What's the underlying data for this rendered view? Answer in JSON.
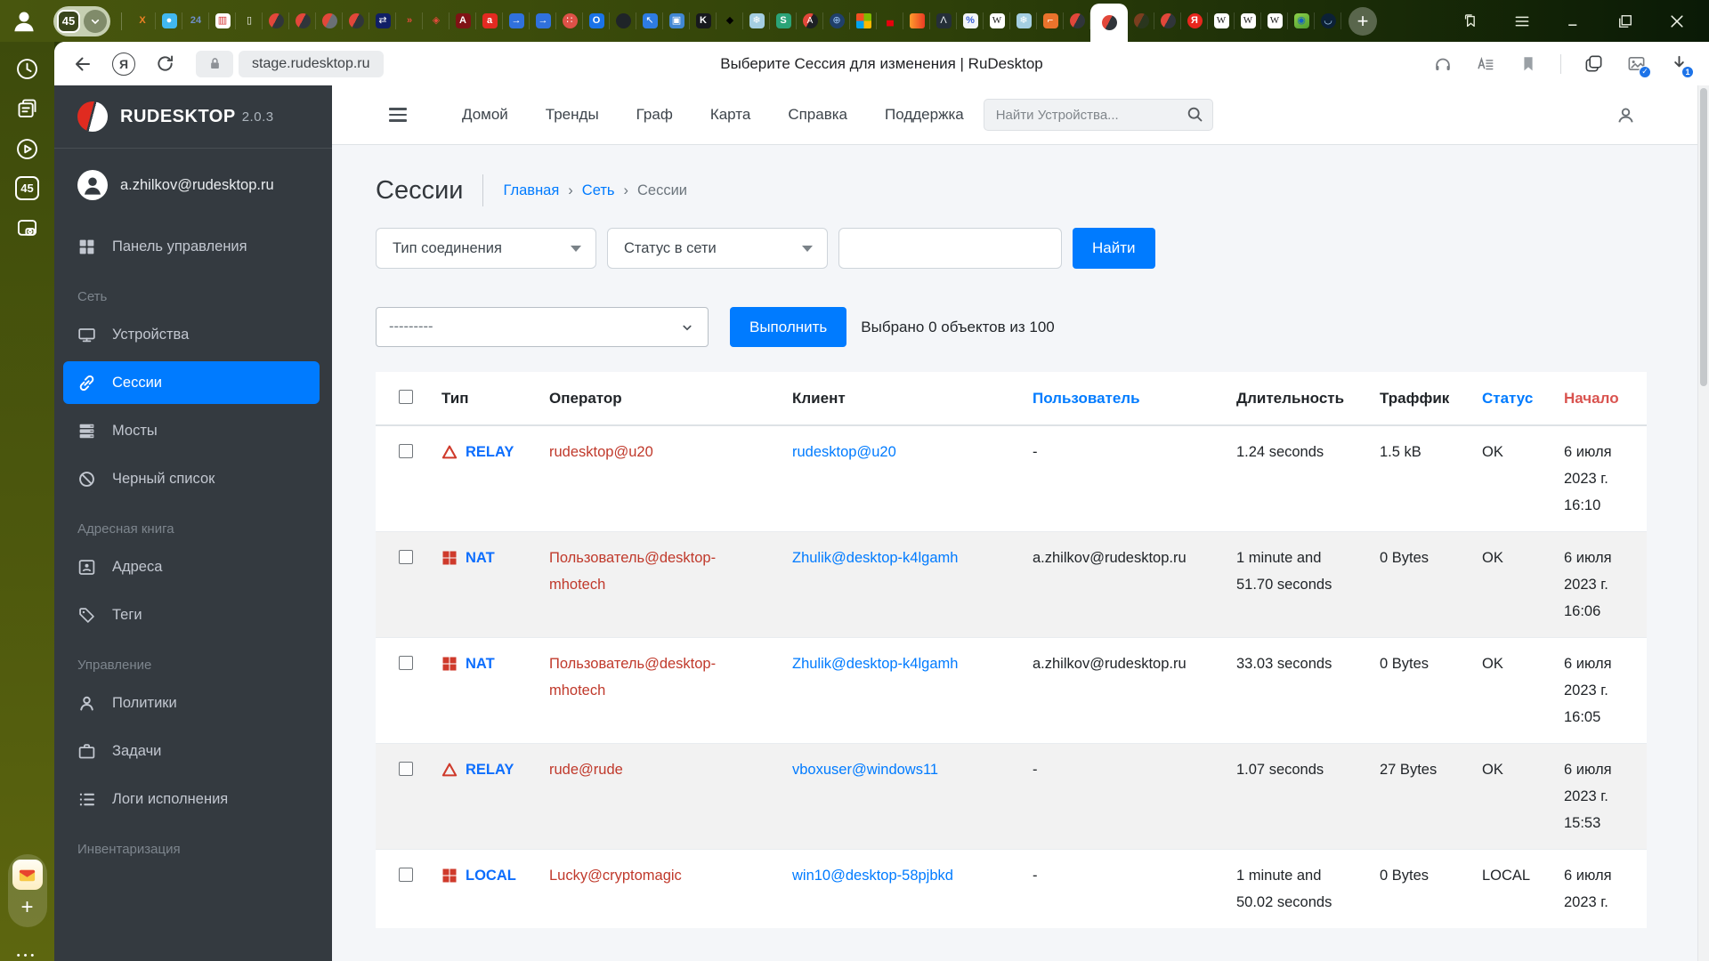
{
  "colors": {
    "accent": "#007bff",
    "type_blue": "#0d6efd",
    "operator_red": "#c0392b",
    "sort_red": "#d9534f",
    "icon_red": "#cf3a2b",
    "sidebar_bg": "#343a40"
  },
  "browser": {
    "page_title": "Выберите Сессия для изменения | RuDesktop",
    "url": "stage.rudesktop.ru",
    "tab_counter": "45",
    "tabs": [
      {
        "s": "no",
        "g": "X",
        "fg": "#f08224",
        "b": true
      },
      {
        "s": "sq",
        "g": "●",
        "bg": "#41b8f1",
        "fg": "#ffffff"
      },
      {
        "s": "no",
        "g": "24",
        "fg": "#6f8fc9",
        "b": true
      },
      {
        "s": "sq",
        "g": "▥",
        "bg": "#ffffff",
        "fg": "#d32f2f"
      },
      {
        "s": "no",
        "g": "▯",
        "fg": "#f2f4ef"
      },
      {
        "s": "rd"
      },
      {
        "s": "rd"
      },
      {
        "s": "rd2"
      },
      {
        "s": "rd"
      },
      {
        "s": "sq",
        "g": "⇄",
        "bg": "#101f66",
        "fg": "#ffffff"
      },
      {
        "s": "no",
        "g": "»",
        "fg": "#e64a3c",
        "b": true
      },
      {
        "s": "no",
        "g": "◈",
        "fg": "#e64a3c"
      },
      {
        "s": "sq",
        "g": "A",
        "bg": "#801315",
        "fg": "#ffffff",
        "b": true
      },
      {
        "s": "sq",
        "g": "a",
        "bg": "#e32a21",
        "fg": "#ffffff",
        "b": true
      },
      {
        "s": "sq",
        "g": "→",
        "bg": "#3071dd",
        "fg": "#ffffff"
      },
      {
        "s": "sq",
        "g": "→",
        "bg": "#3071dd",
        "fg": "#ffffff"
      },
      {
        "s": "ci",
        "g": "∷",
        "bg": "#de5147",
        "fg": "#ffffff"
      },
      {
        "s": "sq",
        "g": "O",
        "bg": "#1a73e8",
        "fg": "#ffffff",
        "b": true
      },
      {
        "s": "ci",
        "g": "",
        "bg": "#1f2428",
        "fg": "#ffffff"
      },
      {
        "s": "sq",
        "g": "↖",
        "bg": "#2e7ce2",
        "fg": "#ffffff"
      },
      {
        "s": "sq",
        "g": "▣",
        "bg": "#4187d3",
        "fg": "#ffffff"
      },
      {
        "s": "sq",
        "g": "K",
        "bg": "#17191d",
        "fg": "#ffffff",
        "b": true
      },
      {
        "s": "no",
        "g": "◆",
        "fg": "#000000"
      },
      {
        "s": "sq",
        "g": "❄",
        "bg": "#a4cee2",
        "fg": "#ffffff"
      },
      {
        "s": "sq",
        "g": "S",
        "bg": "#2ba377",
        "fg": "#ffffff",
        "b": true
      },
      {
        "s": "tr",
        "g": "А"
      },
      {
        "s": "ci",
        "g": "⊕",
        "bg": "#20406b",
        "fg": "#9cc3f0"
      },
      {
        "s": "ms"
      },
      {
        "s": "no",
        "g": "▄",
        "fg": "#e8000d"
      },
      {
        "s": "or"
      },
      {
        "s": "sq",
        "g": "Λ",
        "bg": "#252f38",
        "fg": "#e6ebf0"
      },
      {
        "s": "sq",
        "g": "%",
        "bg": "#f2f5f8",
        "fg": "#3b62da",
        "b": true
      },
      {
        "s": "sq",
        "g": "W",
        "bg": "#ffffff",
        "fg": "#161616",
        "sf": true
      },
      {
        "s": "sq",
        "g": "❄",
        "bg": "#a4cee2",
        "fg": "#ffffff"
      },
      {
        "s": "sq",
        "g": "⌐",
        "bg": "#e9732c",
        "fg": "#ffffff",
        "b": true
      },
      {
        "s": "rd"
      },
      {
        "s": "rd",
        "active": true
      },
      {
        "s": "rd",
        "f": true
      },
      {
        "s": "rd"
      },
      {
        "s": "ci",
        "g": "Я",
        "bg": "#e8261d",
        "fg": "#ffffff",
        "b": true
      },
      {
        "s": "sq",
        "g": "W",
        "bg": "#ffffff",
        "fg": "#161616",
        "sf": true
      },
      {
        "s": "sq",
        "g": "W",
        "bg": "#ffffff",
        "fg": "#161616",
        "sf": true
      },
      {
        "s": "sq",
        "g": "W",
        "bg": "#ffffff",
        "fg": "#161616",
        "sf": true
      },
      {
        "s": "map",
        "g": "◉",
        "fg": "#1461c2"
      },
      {
        "s": "ci",
        "g": "◡",
        "bg": "#0c2136",
        "fg": "#a9d4f5"
      }
    ]
  },
  "strip": {
    "counter": "45"
  },
  "app": {
    "sidebar": {
      "brand": "RUDESKTOP",
      "version": "2.0.3",
      "user": "a.zhilkov@rudesktop.ru",
      "sections": [
        {
          "header": null,
          "items": [
            {
              "icon": "grid",
              "label": "Панель управления"
            }
          ]
        },
        {
          "header": "Сеть",
          "items": [
            {
              "icon": "monitor",
              "label": "Устройства"
            },
            {
              "icon": "link",
              "label": "Сессии",
              "active": true
            },
            {
              "icon": "server",
              "label": "Мосты"
            },
            {
              "icon": "ban",
              "label": "Черный список"
            }
          ]
        },
        {
          "header": "Адресная книга",
          "items": [
            {
              "icon": "card",
              "label": "Адреса"
            },
            {
              "icon": "tag",
              "label": "Теги"
            }
          ]
        },
        {
          "header": "Управление",
          "items": [
            {
              "icon": "user",
              "label": "Политики"
            },
            {
              "icon": "case",
              "label": "Задачи"
            },
            {
              "icon": "list",
              "label": "Логи исполнения"
            }
          ]
        },
        {
          "header": "Инвентаризация",
          "items": []
        }
      ]
    },
    "nav": {
      "items": [
        "Домой",
        "Тренды",
        "Граф",
        "Карта",
        "Справка",
        "Поддержка"
      ],
      "search_placeholder": "Найти Устройства..."
    },
    "page": {
      "title": "Сессии",
      "breadcrumbs": [
        {
          "label": "Главная"
        },
        {
          "label": "Сеть"
        },
        {
          "label": "Сессии",
          "current": true
        }
      ]
    },
    "filters": {
      "connection_type": "Тип соединения",
      "network_status": "Статус в сети",
      "find": "Найти"
    },
    "actions": {
      "action_placeholder": "---------",
      "execute": "Выполнить",
      "selection_info": "Выбрано 0 объектов из 100"
    },
    "table": {
      "columns": [
        {
          "label": "Тип"
        },
        {
          "label": "Оператор"
        },
        {
          "label": "Клиент"
        },
        {
          "label": "Пользователь",
          "color": "#007bff"
        },
        {
          "label": "Длительность"
        },
        {
          "label": "Траффик"
        },
        {
          "label": "Статус",
          "color": "#007bff"
        },
        {
          "label": "Начало",
          "color": "#d9534f"
        }
      ],
      "rows": [
        {
          "os": "relay",
          "type": "RELAY",
          "operator": "rudesktop@u20",
          "client": "rudesktop@u20",
          "user": "-",
          "duration": "1.24 seconds",
          "traffic": "1.5 kB",
          "status": "OK",
          "started": "6 июля 2023 г. 16:10"
        },
        {
          "os": "windows",
          "type": "NAT",
          "operator": "Пользователь@desktop-mhotech",
          "client": "Zhulik@desktop-k4lgamh",
          "user": "a.zhilkov@rudesktop.ru",
          "duration": "1 minute and 51.70 seconds",
          "traffic": "0 Bytes",
          "status": "OK",
          "started": "6 июля 2023 г. 16:06"
        },
        {
          "os": "windows",
          "type": "NAT",
          "operator": "Пользователь@desktop-mhotech",
          "client": "Zhulik@desktop-k4lgamh",
          "user": "a.zhilkov@rudesktop.ru",
          "duration": "33.03 seconds",
          "traffic": "0 Bytes",
          "status": "OK",
          "started": "6 июля 2023 г. 16:05"
        },
        {
          "os": "relay",
          "type": "RELAY",
          "operator": "rude@rude",
          "client": "vboxuser@windows11",
          "user": "-",
          "duration": "1.07 seconds",
          "traffic": "27 Bytes",
          "status": "OK",
          "started": "6 июля 2023 г. 15:53"
        },
        {
          "os": "windows",
          "type": "LOCAL",
          "operator": "Lucky@cryptomagic",
          "client": "win10@desktop-58pjbkd",
          "user": "-",
          "duration": "1 minute and 50.02 seconds",
          "traffic": "0 Bytes",
          "status": "LOCAL",
          "started": "6 июля 2023 г."
        }
      ]
    }
  }
}
